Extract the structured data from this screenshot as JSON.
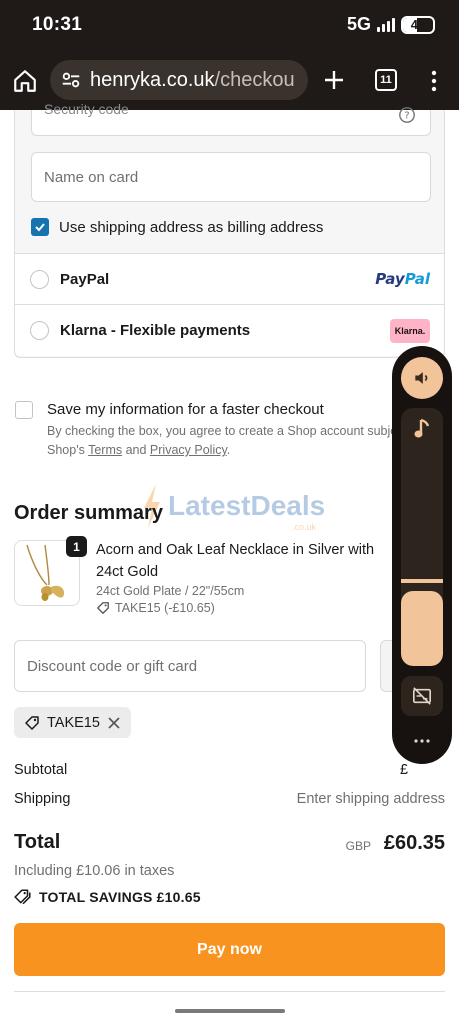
{
  "status_bar": {
    "time": "10:31",
    "network": "5G",
    "battery_level": "45",
    "battery_fraction": 0.45
  },
  "browser": {
    "url_host": "henryka.co.uk",
    "url_path": "/checkou",
    "tab_count": "11"
  },
  "payment": {
    "security_code_placeholder": "Security code",
    "name_on_card_placeholder": "Name on card",
    "billing_same_label": "Use shipping address as billing address",
    "billing_same_checked": true,
    "options": [
      {
        "label": "PayPal",
        "logo_text_1": "Pay",
        "logo_text_2": "Pal"
      },
      {
        "label": "Klarna - Flexible payments",
        "logo_text": "Klarna."
      }
    ]
  },
  "save_info": {
    "title": "Save my information for a faster checkout",
    "desc_prefix": "By checking the box, you agree to create a Shop account subje",
    "desc_mid": "Shop's ",
    "terms_link": "Terms",
    "and_text": " and ",
    "privacy_link": "Privacy Policy",
    "desc_suffix": "."
  },
  "watermark": {
    "text": "LatestDeals",
    "sub": ".co.uk"
  },
  "order_summary": {
    "title": "Order summary",
    "product": {
      "quantity": "1",
      "name": "Acorn and Oak Leaf Necklace in Silver with 24ct Gold",
      "variant": "24ct Gold Plate / 22\"/55cm",
      "discount": "TAKE15 (-£10.65)"
    },
    "discount_placeholder": "Discount code or gift card",
    "applied_code": "TAKE15",
    "subtotal_label": "Subtotal",
    "subtotal_peek": "£",
    "shipping_label": "Shipping",
    "shipping_value": "Enter shipping address",
    "total_label": "Total",
    "currency": "GBP",
    "total_value": "£60.35",
    "taxes": "Including £10.06 in taxes",
    "savings": "TOTAL SAVINGS  £10.65",
    "pay_button": "Pay now"
  },
  "media_panel": {
    "volume_level": 0.29
  },
  "colors": {
    "bar_background": "#1f1a17",
    "accent_blue": "#1773b0",
    "pay_button": "#f7931e",
    "media_accent": "#f2c49a"
  },
  "icons": {
    "home": "home-icon",
    "site_info": "site-info-icon",
    "new_tab": "plus-icon",
    "menu": "more-vert-icon",
    "help": "question-circle-icon",
    "tag": "tag-icon",
    "close": "close-icon",
    "volume": "volume-icon",
    "music": "music-note-icon",
    "captions_off": "captions-off-icon",
    "more": "more-horiz-icon"
  }
}
